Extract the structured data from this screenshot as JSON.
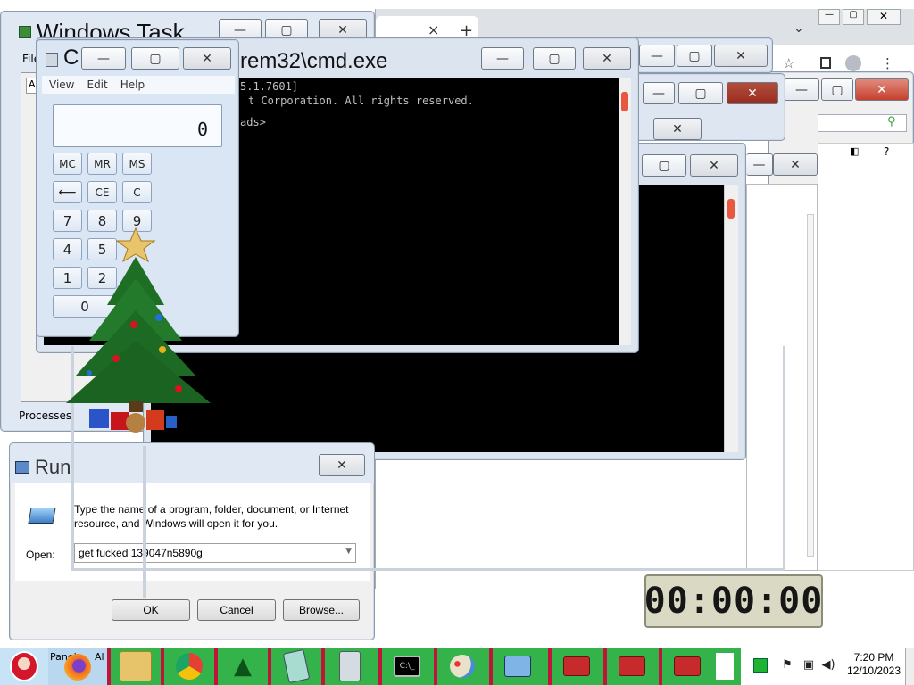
{
  "taskmgr": {
    "title": "Windows Task",
    "menu_file": "File",
    "tab_ap": "Ap",
    "processes_label": "Processes"
  },
  "browser": {
    "tab_close": "×",
    "new_tab": "+",
    "dropdown": "⌄"
  },
  "cmd": {
    "title": "rem32\\cmd.exe",
    "lines": [
      "5.1.7601]",
      "t Corporation.  All rights reserved.",
      "",
      "ads>"
    ]
  },
  "calc": {
    "title": "C",
    "menu": [
      "View",
      "Edit",
      "Help"
    ],
    "display": "0",
    "mem_buttons": [
      "MC",
      "MR",
      "MS"
    ],
    "row2": [
      "⟵",
      "CE",
      "C"
    ],
    "row3": [
      "7",
      "8",
      "9"
    ],
    "row4": [
      "4",
      "5"
    ],
    "row5": [
      "1",
      "2"
    ],
    "zero": "0"
  },
  "run": {
    "title": "Run",
    "description_line1": "Type the name of a program, folder, document, or Internet",
    "description_line2": "resource, and Windows will open it for you.",
    "open_label": "Open:",
    "open_value": "get fucked 139047n5890g",
    "ok": "OK",
    "cancel": "Cancel",
    "browse": "Browse..."
  },
  "clock_widget": {
    "time": "00:00:00"
  },
  "panel_item": {
    "label": "Panel"
  },
  "al_item": {
    "label": "Al"
  },
  "tray": {
    "time": "7:20 PM",
    "date": "12/10/2023"
  },
  "help_icon": "?",
  "colors": {
    "taskbar_green": "#34b34a",
    "taskbar_stripe": "#c0143c",
    "console_bg": "#000000",
    "scroll_red": "#e8573f"
  }
}
